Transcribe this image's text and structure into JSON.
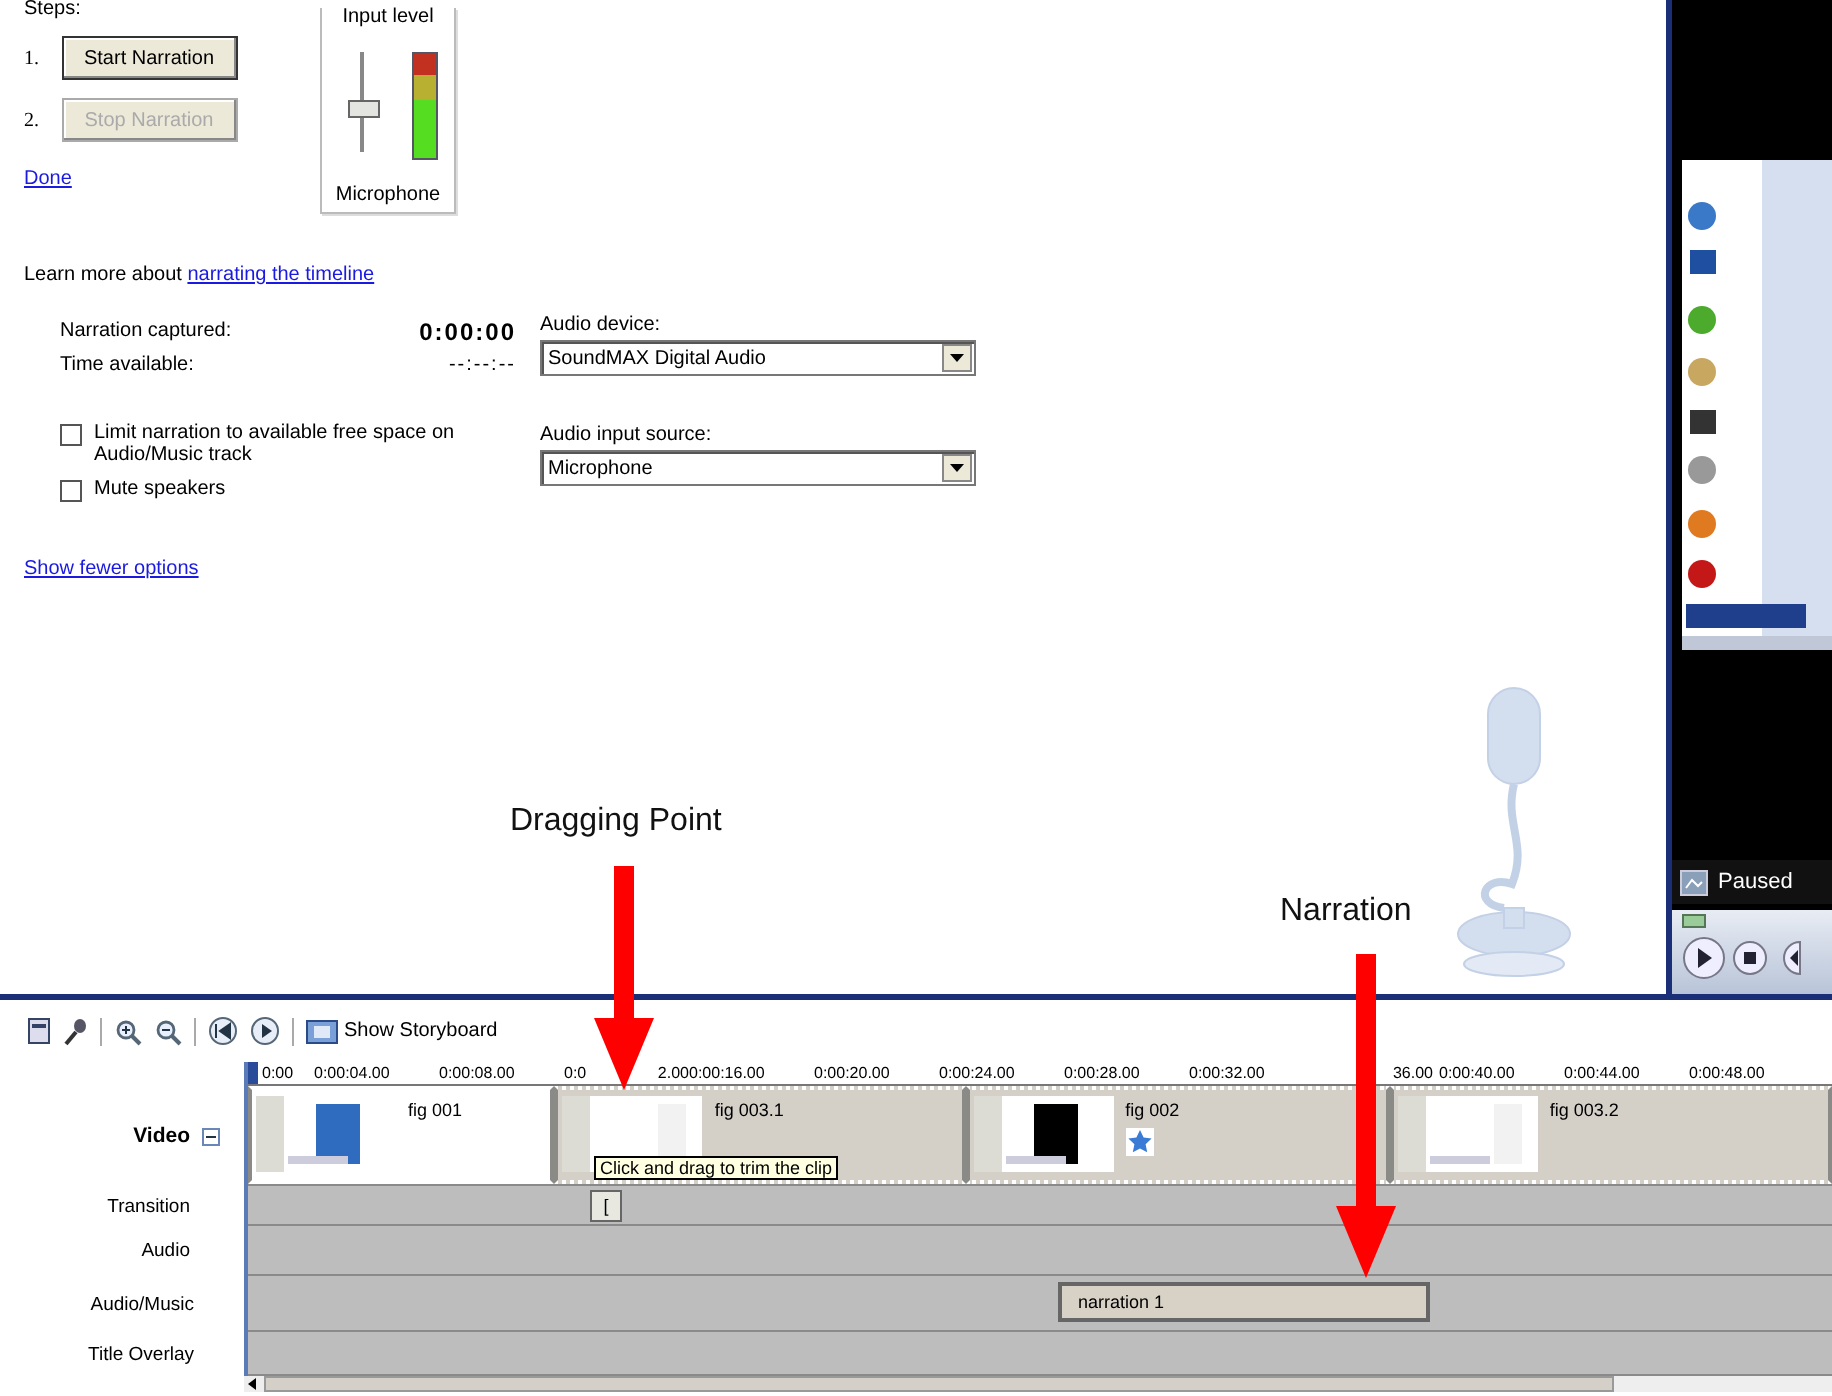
{
  "narration_panel": {
    "steps_label": "Steps:",
    "steps": [
      {
        "number": "1.",
        "button": "Start Narration",
        "disabled": false
      },
      {
        "number": "2.",
        "button": "Stop Narration",
        "disabled": true
      }
    ],
    "done_link": "Done",
    "input_level": {
      "title": "Input level",
      "slider": {
        "level": 0.45
      },
      "meter": {
        "level": 0.55
      },
      "source": "Microphone"
    },
    "learn_more": {
      "text": "Learn more about ",
      "link": "narrating the timeline"
    },
    "stats": [
      {
        "label": "Narration captured:",
        "value": "0:00:00",
        "kind": "bold"
      },
      {
        "label": "Time available:",
        "value": "--:--:--",
        "kind": "plain"
      }
    ],
    "options": [
      {
        "label": "Limit narration to available free space on Audio/Music track",
        "checked": false
      },
      {
        "label": "Mute speakers",
        "checked": false
      }
    ],
    "selects": [
      {
        "label": "Audio device:",
        "value": "SoundMAX Digital Audio"
      },
      {
        "label": "Audio input source:",
        "value": "Microphone"
      }
    ],
    "fewer_link": "Show fewer options"
  },
  "preview": {
    "status": "Paused"
  },
  "annotations": [
    {
      "text": "Dragging Point",
      "kind": "drag"
    },
    {
      "text": "Narration",
      "kind": "narration"
    }
  ],
  "timeline": {
    "storyboard_button": "Show Storyboard",
    "ruler": [
      {
        "label": "0:00"
      },
      {
        "label": "0:00:04.00"
      },
      {
        "label": "0:00:08.00"
      },
      {
        "before": "0:0",
        "after": "2.00"
      },
      {
        "label": "0:00:16.00"
      },
      {
        "label": "0:00:20.00"
      },
      {
        "label": "0:00:24.00"
      },
      {
        "label": "0:00:28.00"
      },
      {
        "label": "0:00:32.00"
      },
      {
        "after": "36.00"
      },
      {
        "label": "0:00:40.00"
      },
      {
        "label": "0:00:44.00"
      },
      {
        "label": "0:00:48.00"
      }
    ],
    "tracks": [
      {
        "label": "Video",
        "expanded": true,
        "children": [
          {
            "label": "Transition"
          },
          {
            "label": "Audio"
          }
        ]
      },
      {
        "label": "Audio/Music"
      },
      {
        "label": "Title Overlay"
      }
    ],
    "video_clips": [
      {
        "name": "fig 001",
        "effect": false
      },
      {
        "name": "fig 003.1",
        "effect": false
      },
      {
        "name": "fig 002",
        "effect": true
      },
      {
        "name": "fig 003.2",
        "effect": false
      }
    ],
    "tooltip": "Click and drag to trim the clip",
    "transition_marker": "[",
    "music_clips": [
      {
        "name": "narration 1"
      }
    ]
  }
}
